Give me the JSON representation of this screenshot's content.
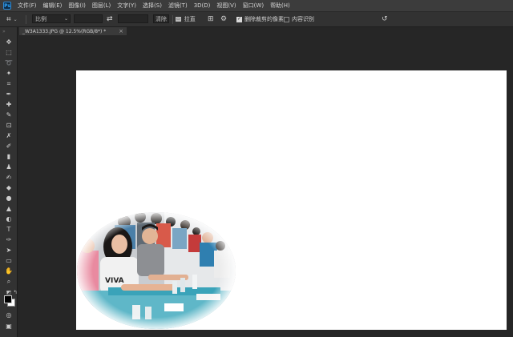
{
  "app": {
    "logo_text": "Ps"
  },
  "menu": [
    "文件(F)",
    "编辑(E)",
    "图像(I)",
    "图层(L)",
    "文字(Y)",
    "选择(S)",
    "滤镜(T)",
    "3D(D)",
    "视图(V)",
    "窗口(W)",
    "帮助(H)"
  ],
  "options": {
    "ratio_label": "比例",
    "clear_label": "清除",
    "straighten_label": "拉直",
    "delete_cropped": {
      "label": "删除裁剪的像素",
      "checked": true
    },
    "content_aware": {
      "label": "内容识别",
      "checked": false
    }
  },
  "document": {
    "tab_title": "_W3A1333.JPG @ 12.5%(RGB/8*) *",
    "close_glyph": "×"
  },
  "toolbar": {
    "tools": [
      {
        "name": "move-tool",
        "glyph": "✥"
      },
      {
        "name": "marquee-tool",
        "glyph": "⬚"
      },
      {
        "name": "lasso-tool",
        "glyph": "➰"
      },
      {
        "name": "magic-wand-tool",
        "glyph": "✦"
      },
      {
        "name": "crop-tool",
        "glyph": "⌗"
      },
      {
        "name": "eyedropper-tool",
        "glyph": "✒"
      },
      {
        "name": "healing-brush-tool",
        "glyph": "✚"
      },
      {
        "name": "brush-tool",
        "glyph": "✎"
      },
      {
        "name": "stamp-tool",
        "glyph": "⊡"
      },
      {
        "name": "history-brush-tool",
        "glyph": "✗"
      },
      {
        "name": "eraser-tool",
        "glyph": "✐"
      },
      {
        "name": "gradient-tool",
        "glyph": "▮"
      },
      {
        "name": "stamp-solid-tool",
        "glyph": "♟"
      },
      {
        "name": "mixer-brush-tool",
        "glyph": "✍"
      },
      {
        "name": "paint-bucket-tool",
        "glyph": "◆"
      },
      {
        "name": "blur-tool",
        "glyph": "●"
      },
      {
        "name": "sharpen-tool",
        "glyph": "▲"
      },
      {
        "name": "dodge-tool",
        "glyph": "◐"
      },
      {
        "name": "type-tool",
        "glyph": "T"
      },
      {
        "name": "pen-tool",
        "glyph": "✑"
      },
      {
        "name": "path-selection-tool",
        "glyph": "➤"
      },
      {
        "name": "rectangle-tool",
        "glyph": "▭"
      },
      {
        "name": "hand-tool",
        "glyph": "✋"
      },
      {
        "name": "zoom-tool",
        "glyph": "⌕"
      },
      {
        "name": "more-tools",
        "glyph": "···"
      }
    ],
    "bottom": [
      {
        "name": "quick-mask-icon",
        "glyph": "◎"
      },
      {
        "name": "screen-mode-icon",
        "glyph": "▣"
      }
    ]
  },
  "colors": {
    "foreground": "#000000",
    "background": "#ffffff",
    "canvas": "#ffffff",
    "workspace": "#262626"
  }
}
